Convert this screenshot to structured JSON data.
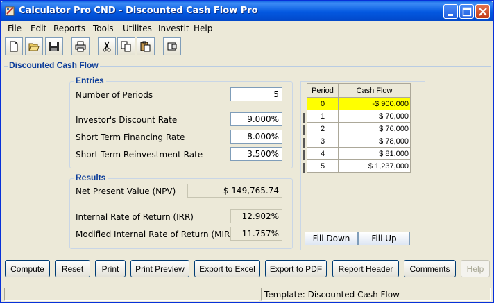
{
  "window": {
    "title": "Calculator Pro CND - Discounted Cash Flow Pro"
  },
  "menu": [
    {
      "label": "File"
    },
    {
      "label": "Edit"
    },
    {
      "label": "Reports"
    },
    {
      "label": "Tools"
    },
    {
      "label": "Utilites"
    },
    {
      "label": "Investit"
    },
    {
      "label": "Help"
    }
  ],
  "toolbar": {
    "icons": [
      "new-file-icon",
      "open-folder-icon",
      "save-icon",
      "print-icon",
      "cut-icon",
      "copy-icon",
      "paste-icon",
      "calculator-icon"
    ]
  },
  "panel": {
    "title": "Discounted Cash Flow"
  },
  "entries": {
    "title": "Entries",
    "num_periods_label": "Number of Periods",
    "num_periods_value": "5",
    "discount_rate_label": "Investor's Discount Rate",
    "discount_rate_value": "9.000%",
    "financing_rate_label": "Short Term Financing Rate",
    "financing_rate_value": "8.000%",
    "reinvest_rate_label": "Short Term Reinvestment Rate",
    "reinvest_rate_value": "3.500%"
  },
  "results": {
    "title": "Results",
    "npv_label": "Net Present Value (NPV)",
    "npv_value": "$ 149,765.74",
    "irr_label": "Internal Rate of Return (IRR)",
    "irr_value": "12.902%",
    "mirr_label": "Modified Internal Rate of Return (MIRR)",
    "mirr_value": "11.757%"
  },
  "cashflow": {
    "col_period": "Period",
    "col_cash": "Cash Flow",
    "rows": [
      {
        "period": "0",
        "amount": "-$ 900,000"
      },
      {
        "period": "1",
        "amount": "$ 70,000"
      },
      {
        "period": "2",
        "amount": "$ 76,000"
      },
      {
        "period": "3",
        "amount": "$ 78,000"
      },
      {
        "period": "4",
        "amount": "$ 81,000"
      },
      {
        "period": "5",
        "amount": "$ 1,237,000"
      }
    ],
    "fill_down": "Fill Down",
    "fill_up": "Fill Up"
  },
  "buttons": {
    "compute": "Compute",
    "reset": "Reset",
    "print": "Print",
    "print_preview": "Print Preview",
    "export_excel": "Export to Excel",
    "export_pdf": "Export to PDF",
    "report_header": "Report Header",
    "comments": "Comments",
    "help": "Help"
  },
  "status": {
    "left": "",
    "template": "Template: Discounted Cash Flow"
  },
  "colors": {
    "accent": "#0B3C99",
    "selected_row": "#FFFF00",
    "titlebar": "#0358E0"
  }
}
